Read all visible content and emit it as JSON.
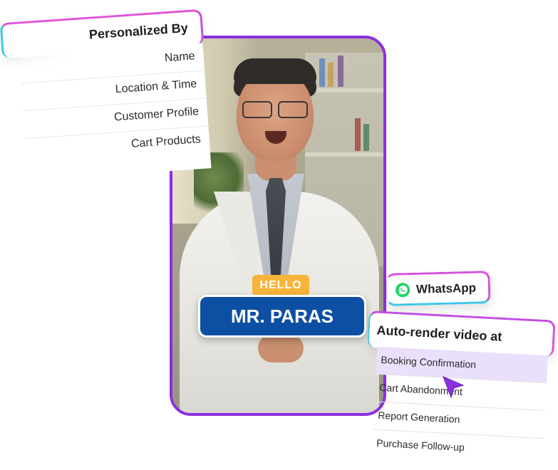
{
  "personalized": {
    "title": "Personalized By",
    "items": [
      "Name",
      "Location & Time",
      "Customer Profile",
      "Cart Products"
    ]
  },
  "video": {
    "greeting": "HELLO",
    "name": "MR. PARAS"
  },
  "channel": {
    "label": "WhatsApp",
    "icon": "whatsapp-icon",
    "color": "#25D366"
  },
  "auto_render": {
    "title": "Auto-render video at",
    "items": [
      "Booking Confirmation",
      "Cart Abandonment",
      "Report Generation",
      "Purchase Follow-up"
    ],
    "selected_index": 1
  },
  "colors": {
    "frame_border": "#8b2fe0",
    "name_badge": "#0d4fa3",
    "hello_badge": "#f6b43a",
    "selected_row": "#ebe0fb"
  }
}
